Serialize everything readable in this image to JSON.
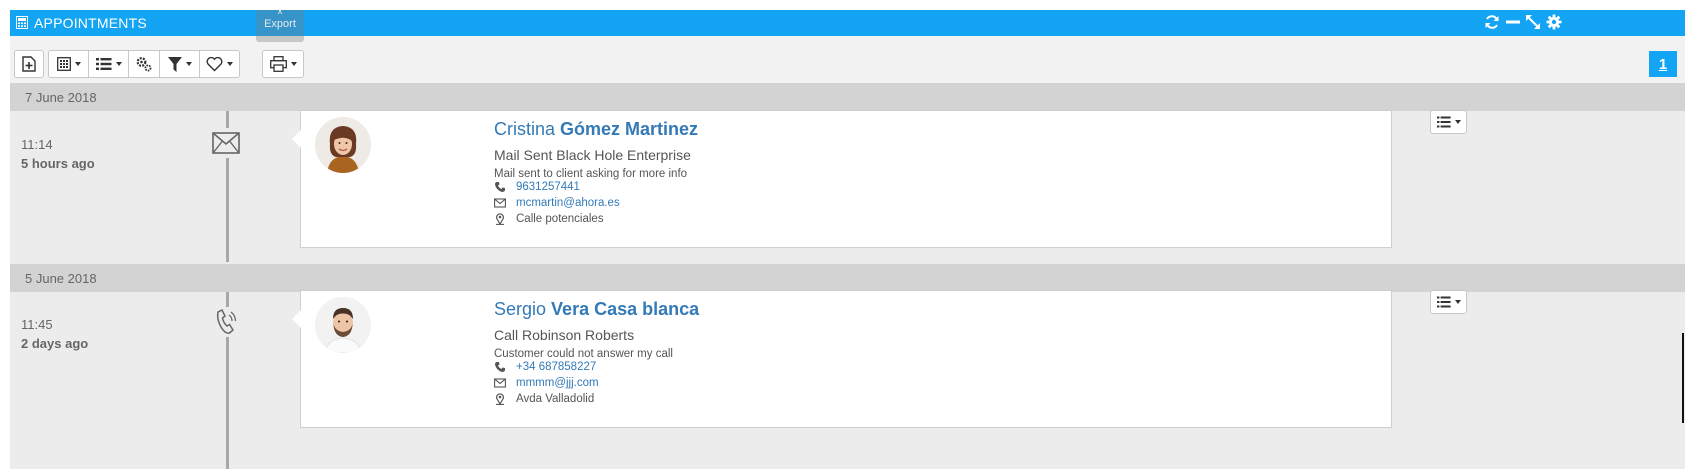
{
  "window": {
    "title": "APPOINTMENTS",
    "controls": [
      "refresh-icon",
      "minimize-icon",
      "expand-icon",
      "gear-icon"
    ]
  },
  "toolbar": {
    "buttons": [
      "new-record-icon",
      "calculator-icon",
      "list-icon",
      "gears-icon",
      "filter-icon",
      "heart-icon",
      "print-icon"
    ],
    "export_tooltip": {
      "close": "x",
      "label": "Export"
    },
    "page_number": "1"
  },
  "timeline": [
    {
      "date": "7 June 2018",
      "time": "11:14",
      "ago": "5 hours ago",
      "type_icon": "envelope-icon",
      "contact": {
        "first_name": "Cristina",
        "last_name": "Gómez Martinez",
        "subject": "Mail Sent Black Hole Enterprise",
        "description": "Mail sent to client asking for more info",
        "phone": "9631257441",
        "email": "mcmartin@ahora.es",
        "address": "Calle potenciales",
        "avatar": "woman-avatar"
      }
    },
    {
      "date": "5 June 2018",
      "time": "11:45",
      "ago": "2 days ago",
      "type_icon": "phone-call-icon",
      "contact": {
        "first_name": "Sergio",
        "last_name": "Vera Casa blanca",
        "subject": "Call Robinson Roberts",
        "description": "Customer could not answer my call",
        "phone": "+34 687858227",
        "email": "mmmm@jjj.com",
        "address": "Avda Valladolid",
        "avatar": "man-avatar"
      }
    }
  ],
  "colors": {
    "accent": "#13a4f4",
    "link": "#337ab7",
    "date_band": "#d3d3d3",
    "panel_bg": "#ececec"
  }
}
